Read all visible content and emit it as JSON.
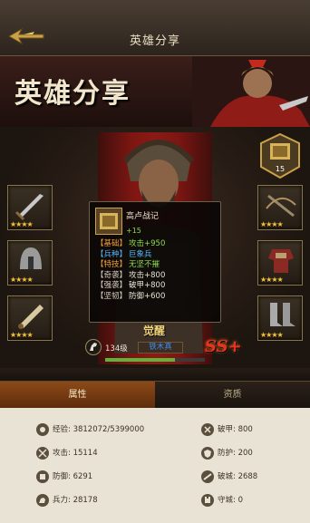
{
  "header": {
    "title": "英雄分享"
  },
  "banner": {
    "title": "英雄分享"
  },
  "emblem": {
    "count": "15"
  },
  "tooltip": {
    "name": "高卢战记",
    "bonus": "+15",
    "rows": [
      {
        "key": "【基础】",
        "val": "攻击+950",
        "style": "g"
      },
      {
        "key": "【兵种】",
        "val": "巨象兵",
        "style": "b"
      },
      {
        "key": "【特技】",
        "val": "无坚不摧",
        "style": "g"
      },
      {
        "key": "【奇袭】",
        "val": "攻击+800",
        "style": "w"
      },
      {
        "key": "【强袭】",
        "val": "破甲+800",
        "style": "w"
      },
      {
        "key": "【坚韧】",
        "val": "防御+600",
        "style": "w"
      }
    ]
  },
  "hero": {
    "awaken_label": "觉醒",
    "level": "134级",
    "name": "铁木真",
    "rank": "SS+",
    "xp_fraction": 0.7
  },
  "equipment": {
    "star_text": "★★★★",
    "left": [
      {
        "icon": "sword-icon"
      },
      {
        "icon": "helmet-icon"
      },
      {
        "icon": "scroll-icon"
      }
    ],
    "right": [
      {
        "icon": "crossbow-icon"
      },
      {
        "icon": "armor-icon"
      },
      {
        "icon": "boots-icon"
      }
    ]
  },
  "tabs": [
    {
      "label": "属性"
    },
    {
      "label": "资质"
    }
  ],
  "stats": [
    {
      "icon": "experience-icon",
      "text": "经验: 3812072/5399000"
    },
    {
      "icon": "armor-break-icon",
      "text": "破甲: 800"
    },
    {
      "icon": "attack-icon",
      "text": "攻击: 15114"
    },
    {
      "icon": "protection-icon",
      "text": "防护: 200"
    },
    {
      "icon": "defense-icon",
      "text": "防御: 6291"
    },
    {
      "icon": "siege-icon",
      "text": "破城: 2688"
    },
    {
      "icon": "troops-icon",
      "text": "兵力: 28178"
    },
    {
      "icon": "city-defense-icon",
      "text": "守城: 0"
    }
  ],
  "colors": {
    "accent": "#8c4a18",
    "gold": "#f3c13a",
    "green": "#8ddc4a",
    "blue": "#55b8f4",
    "orange": "#f0a236",
    "rank": "#e83418"
  }
}
